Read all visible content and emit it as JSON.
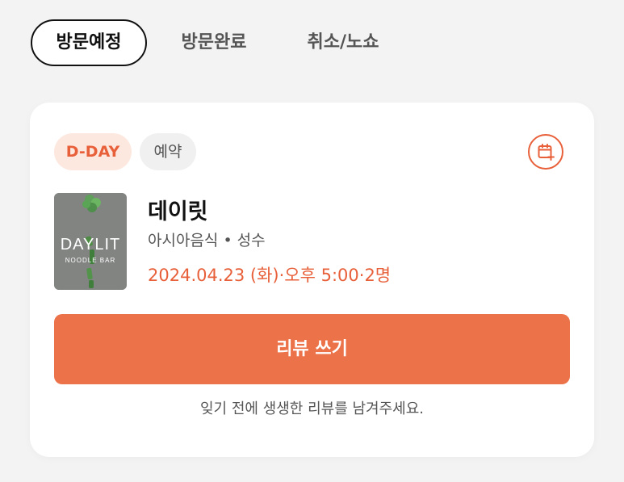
{
  "tabs": {
    "upcoming": "방문예정",
    "completed": "방문완료",
    "canceled": "취소/노쇼"
  },
  "card": {
    "badge_dday": "D-DAY",
    "badge_reservation": "예약",
    "calendar_icon": "calendar-add-icon",
    "thumbnail": {
      "logo_text": "DAYLIT",
      "logo_subtext": "NOODLE BAR"
    },
    "restaurant_name": "데이릿",
    "category_location": "아시아음식 • 성수",
    "schedule": "2024.04.23 (화)·오후 5:00·2명",
    "review_button": "리뷰 쓰기",
    "review_note": "잊기 전에 생생한 리뷰를 남겨주세요."
  },
  "colors": {
    "accent": "#ec724a",
    "accent_text": "#e8603a",
    "dday_badge_bg": "#fde8df",
    "background": "#f3f3f3"
  }
}
